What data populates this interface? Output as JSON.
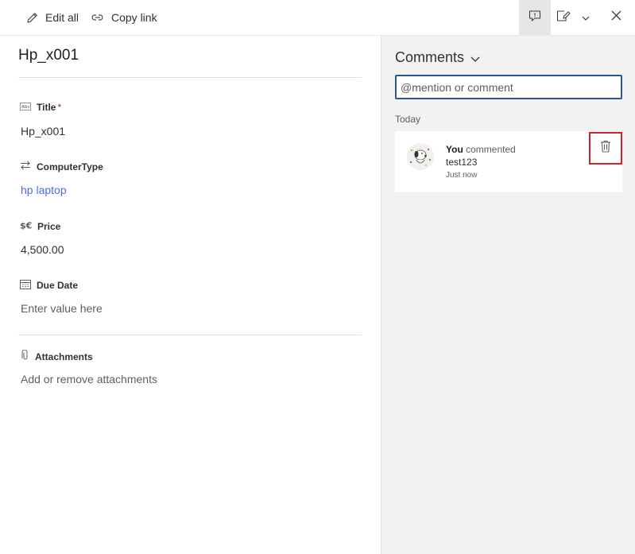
{
  "toolbar": {
    "edit_all": "Edit all",
    "copy_link": "Copy link",
    "icons": [
      "pencil-icon",
      "link-icon",
      "comments-icon",
      "edit-form-icon",
      "chevron-down-icon",
      "close-icon"
    ]
  },
  "item": {
    "title": "Hp_x001"
  },
  "fields": {
    "title": {
      "label": "Title",
      "required_mark": "*",
      "value": "Hp_x001",
      "icon": "text-field-icon"
    },
    "computer_type": {
      "label": "ComputerType",
      "value": "hp laptop",
      "icon": "lookup-icon"
    },
    "price": {
      "label": "Price",
      "value": "4,500.00",
      "icon": "currency-icon"
    },
    "due_date": {
      "label": "Due Date",
      "value": "Enter value here",
      "icon": "calendar-icon"
    },
    "attachments": {
      "label": "Attachments",
      "value": "Add or remove attachments",
      "icon": "paperclip-icon"
    }
  },
  "comments": {
    "header": "Comments",
    "input_placeholder": "@mention or comment",
    "group": "Today",
    "items": [
      {
        "author": "You",
        "action": "commented",
        "text": "test123",
        "time": "Just now"
      }
    ]
  },
  "colors": {
    "accent": "#2b579a",
    "link": "#4f6bed",
    "required": "#a4262c",
    "highlight_border": "#d0222d",
    "pane_background": "#f3f2f1"
  }
}
